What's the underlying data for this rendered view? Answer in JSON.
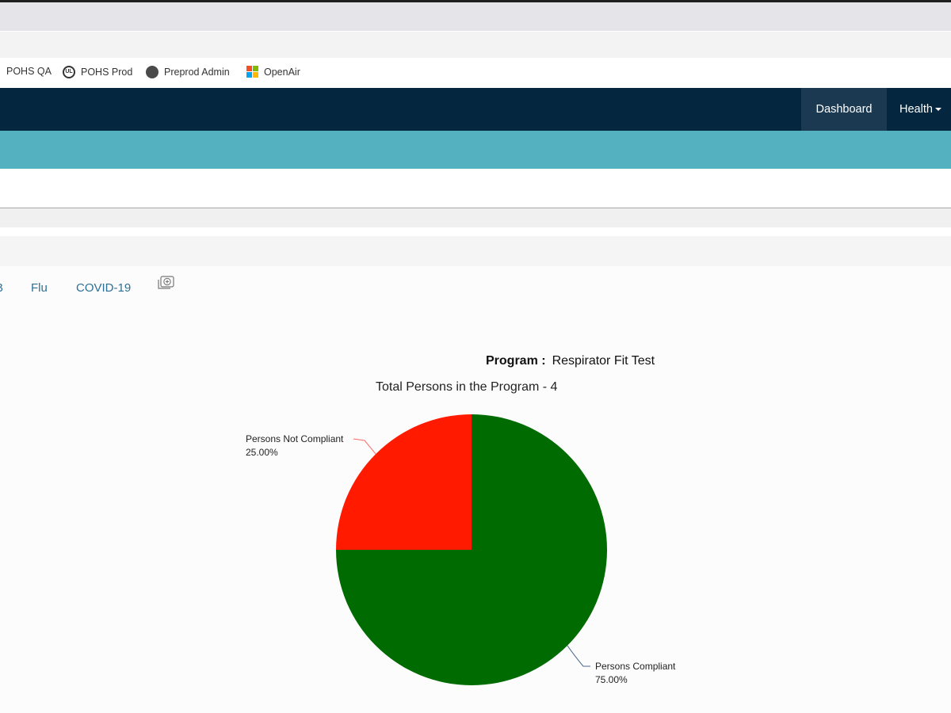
{
  "bookmarks": [
    {
      "label": "POHS QA",
      "icon": "none"
    },
    {
      "label": "POHS Prod",
      "icon": "ul-logo-icon"
    },
    {
      "label": "Preprod Admin",
      "icon": "globe-icon"
    },
    {
      "label": "OpenAir",
      "icon": "microsoft-logo-icon"
    }
  ],
  "navbar": {
    "dashboard": "Dashboard",
    "health": "Health"
  },
  "tabs": {
    "partial": "B",
    "flu": "Flu",
    "covid": "COVID-19"
  },
  "program": {
    "label": "Program :",
    "value": "Respirator Fit Test"
  },
  "colors": {
    "navbar": "#04273f",
    "banner": "#53b1c0",
    "compliant": "#006b00",
    "not_compliant": "#ff1a00",
    "link": "#2f6f92"
  },
  "chart_data": {
    "type": "pie",
    "title": "Total Persons in the Program - 4",
    "slices": [
      {
        "name": "Persons Compliant",
        "value": 75.0,
        "label": "75.00%",
        "color": "#006b00"
      },
      {
        "name": "Persons Not Compliant",
        "value": 25.0,
        "label": "25.00%",
        "color": "#ff1a00"
      }
    ]
  }
}
